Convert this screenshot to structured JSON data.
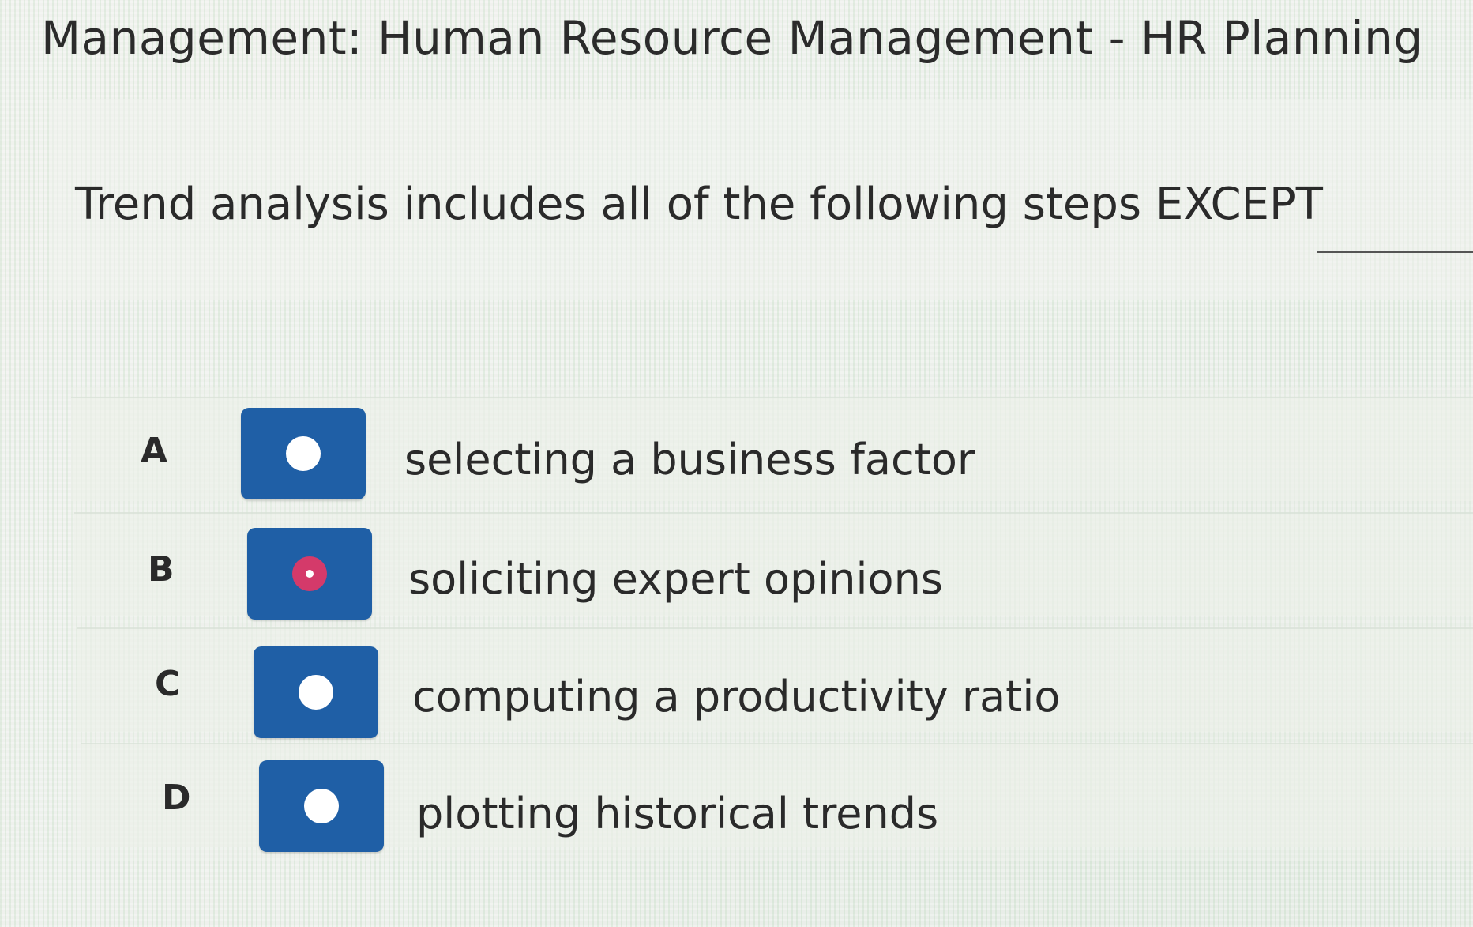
{
  "header": {
    "title": "Management: Human Resource Management - HR Planning"
  },
  "question": {
    "text": "Trend analysis includes all of the following steps EXCEPT"
  },
  "options": [
    {
      "letter": "A",
      "text": "selecting a business factor",
      "selected": false
    },
    {
      "letter": "B",
      "text": "soliciting expert opinions",
      "selected": true
    },
    {
      "letter": "C",
      "text": "computing a productivity ratio",
      "selected": false
    },
    {
      "letter": "D",
      "text": "plotting historical trends",
      "selected": false
    }
  ],
  "colors": {
    "radio_tile": "#1f5fa6",
    "radio_selected": "#d43a6a",
    "radio_unselected": "#ffffff"
  }
}
